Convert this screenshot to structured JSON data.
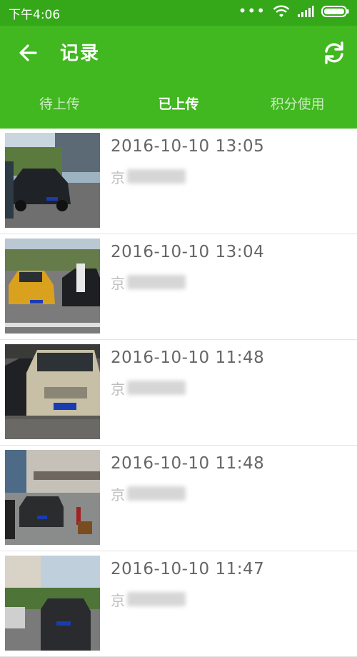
{
  "status_bar": {
    "time": "下午4:06",
    "dots": "•••"
  },
  "header": {
    "title": "记录",
    "back_icon": "arrow-left-icon",
    "refresh_icon": "refresh-icon"
  },
  "tabs": [
    {
      "label": "待上传",
      "active": false
    },
    {
      "label": "已上传",
      "active": true
    },
    {
      "label": "积分使用",
      "active": false
    }
  ],
  "records": [
    {
      "time": "2016-10-10 13:05",
      "plate_prefix": "京",
      "plate_hidden": "blurred"
    },
    {
      "time": "2016-10-10 13:04",
      "plate_prefix": "京",
      "plate_hidden": "blurred"
    },
    {
      "time": "2016-10-10 11:48",
      "plate_prefix": "京",
      "plate_hidden": "blurred"
    },
    {
      "time": "2016-10-10 11:48",
      "plate_prefix": "京",
      "plate_hidden": "blurred"
    },
    {
      "time": "2016-10-10 11:47",
      "plate_prefix": "京",
      "plate_hidden": "blurred"
    }
  ],
  "colors": {
    "status_bar": "#35a819",
    "app_bar": "#41b720",
    "time_text": "#666666"
  }
}
